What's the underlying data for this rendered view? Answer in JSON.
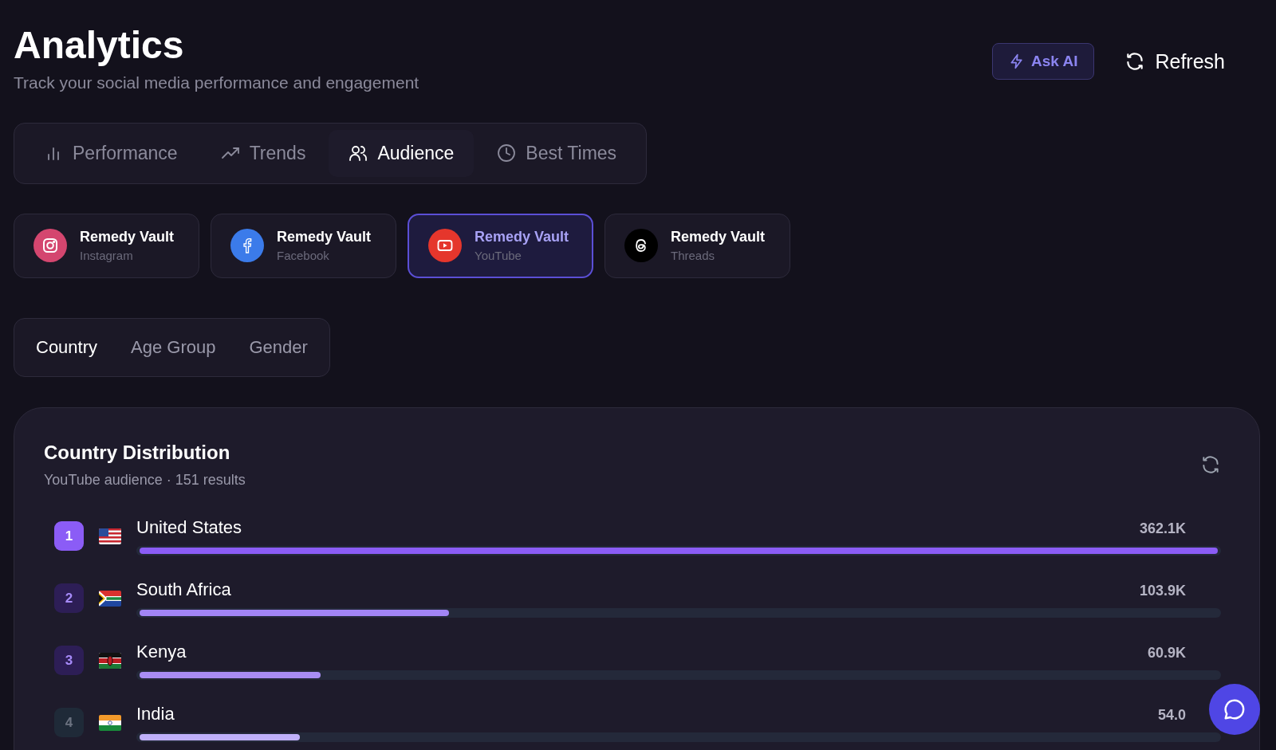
{
  "header": {
    "title": "Analytics",
    "subtitle": "Track your social media performance and engagement",
    "ask_ai": "Ask AI",
    "refresh": "Refresh"
  },
  "tabs": [
    {
      "label": "Performance",
      "kind": "bars",
      "selected": false
    },
    {
      "label": "Trends",
      "kind": "trend",
      "selected": false
    },
    {
      "label": "Audience",
      "kind": "users",
      "selected": true
    },
    {
      "label": "Best Times",
      "kind": "clock",
      "selected": false
    }
  ],
  "accounts": [
    {
      "name": "Remedy Vault",
      "platform": "Instagram",
      "kind": "instagram",
      "color": "#d4466f",
      "selected": false
    },
    {
      "name": "Remedy Vault",
      "platform": "Facebook",
      "kind": "facebook",
      "color": "#3b7bea",
      "selected": false
    },
    {
      "name": "Remedy Vault",
      "platform": "YouTube",
      "kind": "youtube",
      "color": "#e5362c",
      "selected": true
    },
    {
      "name": "Remedy Vault",
      "platform": "Threads",
      "kind": "threads",
      "color": "#000000",
      "selected": false
    }
  ],
  "segments": [
    {
      "label": "Country",
      "selected": true
    },
    {
      "label": "Age Group",
      "selected": false
    },
    {
      "label": "Gender",
      "selected": false
    }
  ],
  "distribution": {
    "title": "Country Distribution",
    "subtitle": "YouTube audience · 151 results",
    "rows": [
      {
        "rank": "1",
        "country": "United States",
        "value": "362.1K",
        "level": 1.0,
        "color": "#8b5cf6"
      },
      {
        "rank": "2",
        "country": "South Africa",
        "value": "103.9K",
        "level": 0.287,
        "color": "#a285f5"
      },
      {
        "rank": "3",
        "country": "Kenya",
        "value": "60.9K",
        "level": 0.168,
        "color": "#a88ef5"
      },
      {
        "rank": "4",
        "country": "India",
        "value": "54.0",
        "level": 0.149,
        "color": "#c0b0fa"
      }
    ]
  }
}
